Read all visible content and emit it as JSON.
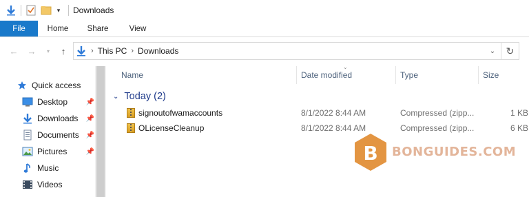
{
  "window": {
    "title": "Downloads",
    "accent_color": "#1979ca"
  },
  "ribbon": {
    "tabs": [
      {
        "label": "File"
      },
      {
        "label": "Home"
      },
      {
        "label": "Share"
      },
      {
        "label": "View"
      }
    ]
  },
  "address_bar": {
    "segments": [
      "This PC",
      "Downloads"
    ]
  },
  "nav_pane": {
    "items": [
      {
        "label": "Quick access",
        "icon": "star-icon"
      },
      {
        "label": "Desktop",
        "icon": "desktop-icon",
        "pinned": true
      },
      {
        "label": "Downloads",
        "icon": "download-arrow-icon",
        "pinned": true
      },
      {
        "label": "Documents",
        "icon": "documents-icon",
        "pinned": true
      },
      {
        "label": "Pictures",
        "icon": "pictures-icon",
        "pinned": true
      },
      {
        "label": "Music",
        "icon": "music-note-icon"
      },
      {
        "label": "Videos",
        "icon": "videos-icon"
      }
    ]
  },
  "file_list": {
    "columns": [
      "Name",
      "Date modified",
      "Type",
      "Size"
    ],
    "group": {
      "label": "Today (2)"
    },
    "rows": [
      {
        "name": "signoutofwamaccounts",
        "date": "8/1/2022 8:44 AM",
        "type": "Compressed (zipp...",
        "size": "1 KB"
      },
      {
        "name": "OLicenseCleanup",
        "date": "8/1/2022 8:44 AM",
        "type": "Compressed (zipp...",
        "size": "6 KB"
      }
    ]
  },
  "watermark": {
    "letter": "B",
    "text": "BONGUIDES.COM",
    "color": "#e3b59a"
  }
}
